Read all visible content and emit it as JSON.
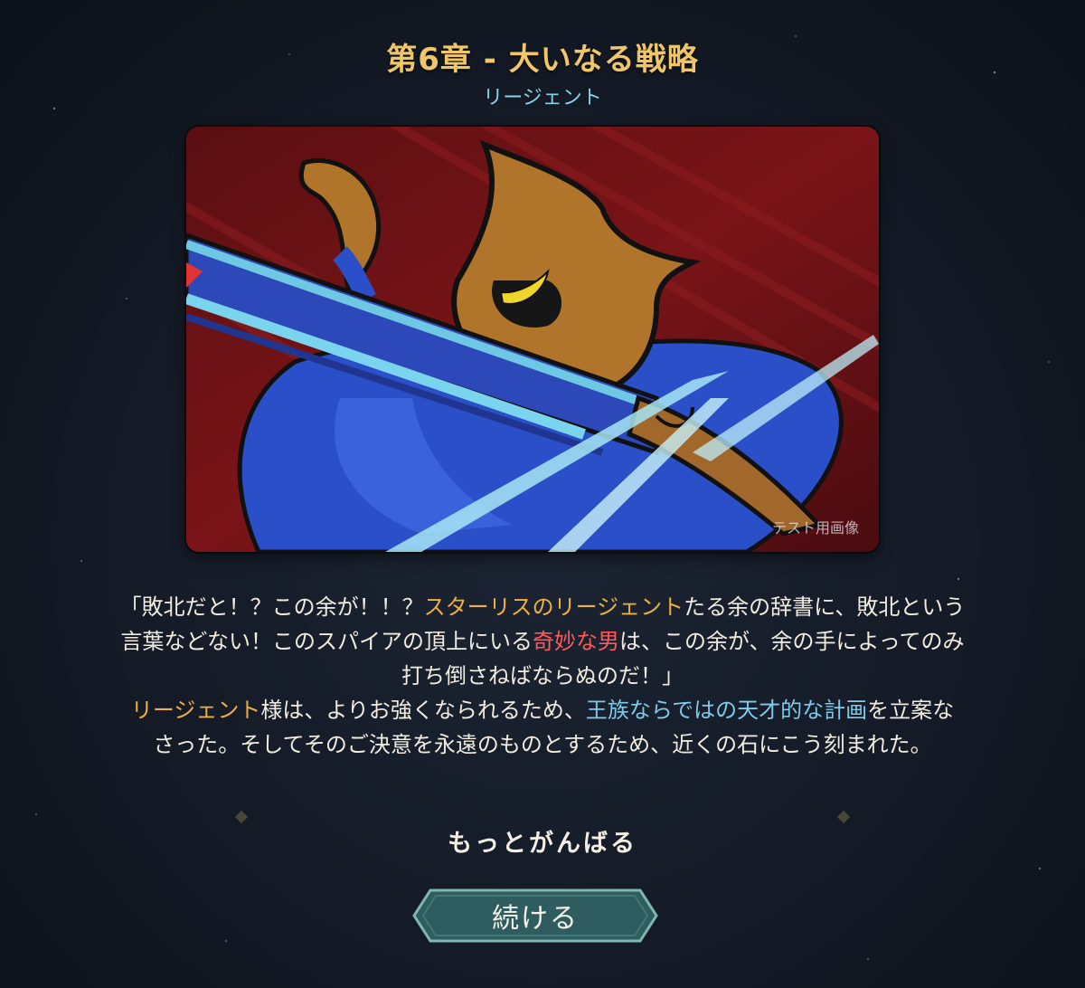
{
  "header": {
    "title": "第6章 - 大いなる戦略",
    "subtitle": "リージェント"
  },
  "artwork": {
    "icon": "regent-character-illustration",
    "label": "テスト用画像"
  },
  "story": {
    "line1_a": "「敗北だと！？この余が！！？",
    "line1_b": "スターリスのリージェント",
    "line1_c": "たる余の辞書に、敗北という",
    "line2_a": "言葉などない！このスパイアの頂上にいる",
    "line2_b": "奇妙な男",
    "line2_c": "は、この余が、余の手によってのみ",
    "line3": "打ち倒さねばならぬのだ！」",
    "line4_a": "リージェント",
    "line4_b": "様は、よりお強くなられるため、",
    "line4_c": "王族ならではの天才的な計画",
    "line4_d": "を立案な",
    "line5": "さった。そしてそのご決意を永遠のものとするため、近くの石にこう刻まれた。"
  },
  "choice": {
    "option_label": "もっとがんばる"
  },
  "buttons": {
    "continue_label": "続ける"
  },
  "colors": {
    "title": "#efc66a",
    "subtitle": "#8ad3e6",
    "highlight_orange": "#f0b040",
    "highlight_red": "#ff5a5a",
    "highlight_blue": "#7fcaea",
    "button_fill": "#2f5d5f",
    "button_border": "#7fb7b0"
  }
}
